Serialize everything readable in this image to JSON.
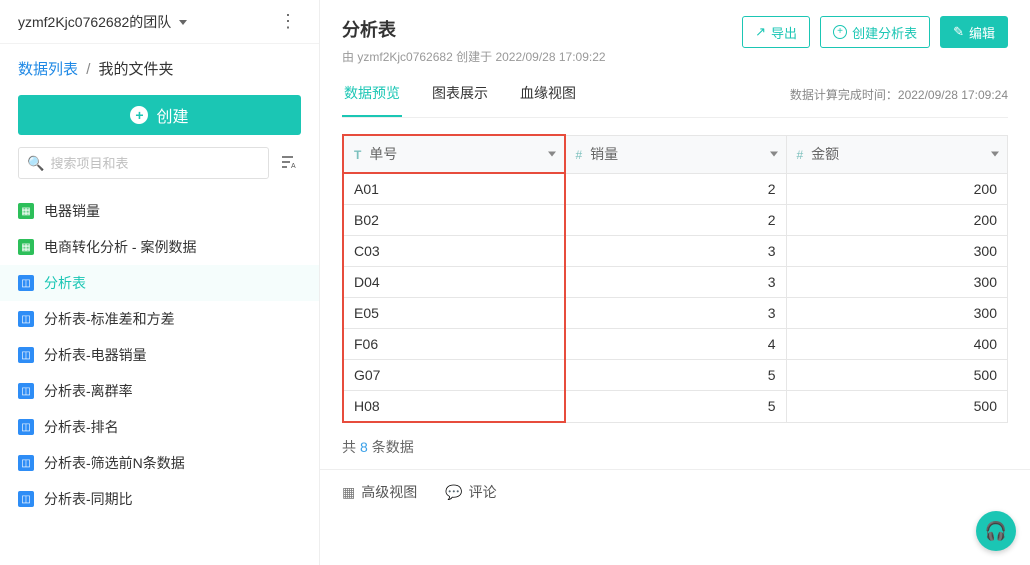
{
  "sidebar": {
    "team_name": "yzmf2Kjc0762682的团队",
    "breadcrumb": {
      "root": "数据列表",
      "current": "我的文件夹"
    },
    "create_label": "创建",
    "search_placeholder": "搜索项目和表",
    "items": [
      {
        "icon": "table",
        "color": "green",
        "label": "电器销量"
      },
      {
        "icon": "table",
        "color": "green",
        "label": "电商转化分析 - 案例数据"
      },
      {
        "icon": "chart",
        "color": "blue",
        "label": "分析表",
        "active": true
      },
      {
        "icon": "chart",
        "color": "blue",
        "label": "分析表-标准差和方差"
      },
      {
        "icon": "chart",
        "color": "blue",
        "label": "分析表-电器销量"
      },
      {
        "icon": "chart",
        "color": "blue",
        "label": "分析表-离群率"
      },
      {
        "icon": "chart",
        "color": "blue",
        "label": "分析表-排名"
      },
      {
        "icon": "chart",
        "color": "blue",
        "label": "分析表-筛选前N条数据"
      },
      {
        "icon": "chart",
        "color": "blue",
        "label": "分析表-同期比"
      }
    ]
  },
  "main": {
    "title": "分析表",
    "meta_by_prefix": "由",
    "meta_user": "yzmf2Kjc0762682",
    "meta_created_prefix": "创建于",
    "meta_created_at": "2022/09/28 17:09:22",
    "actions": {
      "export": "导出",
      "create_table": "创建分析表",
      "edit": "编辑"
    },
    "tabs": [
      {
        "label": "数据预览",
        "active": true
      },
      {
        "label": "图表展示"
      },
      {
        "label": "血缘视图"
      }
    ],
    "compute_time_label": "数据计算完成时间：",
    "compute_time_value": "2022/09/28 17:09:24",
    "table": {
      "columns": [
        {
          "type": "text",
          "type_glyph": "T",
          "label": "单号"
        },
        {
          "type": "number",
          "type_glyph": "#",
          "label": "销量"
        },
        {
          "type": "number",
          "type_glyph": "#",
          "label": "金额"
        }
      ],
      "rows": [
        {
          "id": "A01",
          "qty": 2,
          "amount": 200
        },
        {
          "id": "B02",
          "qty": 2,
          "amount": 200
        },
        {
          "id": "C03",
          "qty": 3,
          "amount": 300
        },
        {
          "id": "D04",
          "qty": 3,
          "amount": 300
        },
        {
          "id": "E05",
          "qty": 3,
          "amount": 300
        },
        {
          "id": "F06",
          "qty": 4,
          "amount": 400
        },
        {
          "id": "G07",
          "qty": 5,
          "amount": 500
        },
        {
          "id": "H08",
          "qty": 5,
          "amount": 500
        }
      ]
    },
    "summary": {
      "prefix": "共",
      "count": 8,
      "suffix": "条数据"
    },
    "footer": {
      "advanced": "高级视图",
      "comment": "评论"
    }
  }
}
